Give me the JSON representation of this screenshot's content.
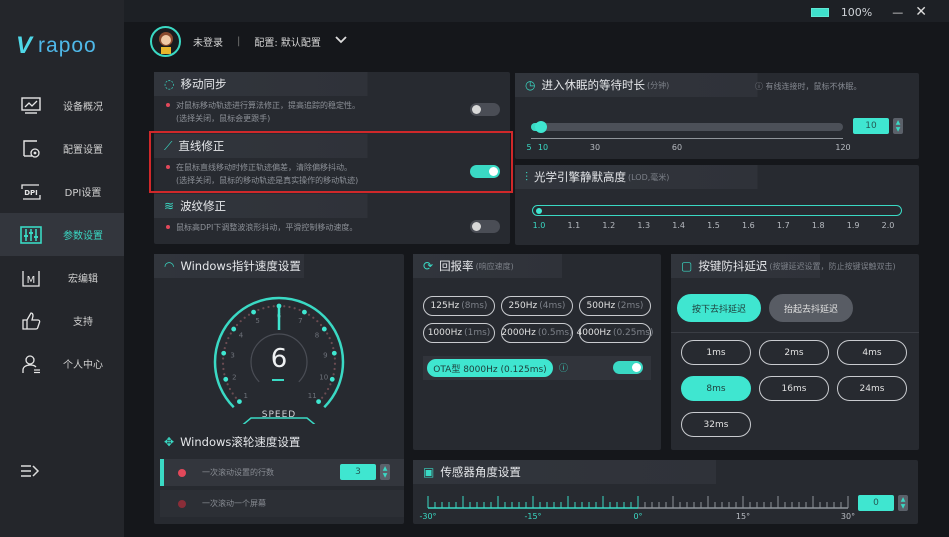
{
  "app": {
    "logo_mark": "V",
    "logo_text": "rapoo"
  },
  "window": {
    "battery": "100%",
    "minimize": "—",
    "close": "✕"
  },
  "sidebar": {
    "items": [
      {
        "label": "设备概况",
        "icon": "monitor-chart-icon"
      },
      {
        "label": "配置设置",
        "icon": "config-gear-icon"
      },
      {
        "label": "DPI设置",
        "icon": "dpi-icon"
      },
      {
        "label": "参数设置",
        "icon": "sliders-icon",
        "active": true
      },
      {
        "label": "宏编辑",
        "icon": "macro-m-icon"
      },
      {
        "label": "支持",
        "icon": "thumbs-up-icon"
      },
      {
        "label": "个人中心",
        "icon": "user-center-icon"
      }
    ],
    "collapse_icon": "menu-collapse-icon"
  },
  "header": {
    "user": "未登录",
    "separator": "|",
    "profile": "配置: 默认配置"
  },
  "motion_sync": {
    "title": "移动同步",
    "desc1": "对鼠标移动轨迹进行算法修正，提高追踪的稳定性。",
    "desc2": "(选择关闭，鼠标会更跟手)",
    "enabled": false
  },
  "angle_snap": {
    "title": "直线修正",
    "desc1": "在鼠标直线移动时修正轨迹偏差，清除偏移抖动。",
    "desc2": "(选择关闭，鼠标的移动轨迹是真实操作的移动轨迹)",
    "enabled": true
  },
  "ripple": {
    "title": "波纹修正",
    "desc1": "鼠标高DPI下调整波浪形抖动，平滑控制移动速度。",
    "enabled": false
  },
  "sleep": {
    "title": "进入休眠的等待时长",
    "unit": "(分钟)",
    "note": "有线连接时，鼠标不休眠。",
    "value": "10",
    "min": 5,
    "max": 120,
    "ticks": [
      "5",
      "10",
      "30",
      "60",
      "120"
    ]
  },
  "lod": {
    "title": "光学引擎静默高度",
    "unit": "(LOD,毫米)",
    "value": 1.0,
    "ticks": [
      "1.0",
      "1.1",
      "1.2",
      "1.3",
      "1.4",
      "1.5",
      "1.6",
      "1.7",
      "1.8",
      "1.9",
      "2.0"
    ]
  },
  "pointer": {
    "title": "Windows指针速度设置",
    "value": "6",
    "label": "SPEED",
    "scale": [
      "1",
      "2",
      "3",
      "4",
      "5",
      "6",
      "7",
      "8",
      "9",
      "10",
      "11"
    ]
  },
  "scroll": {
    "title": "Windows滚轮速度设置",
    "opt1": "一次滚动设置的行数",
    "opt1_value": "3",
    "opt2": "一次滚动一个屏幕"
  },
  "polling": {
    "title": "回报率",
    "unit": "(响应速度)",
    "rates": [
      {
        "hz": "125Hz",
        "ms": "(8ms)"
      },
      {
        "hz": "250Hz",
        "ms": "(4ms)"
      },
      {
        "hz": "500Hz",
        "ms": "(2ms)"
      },
      {
        "hz": "1000Hz",
        "ms": "(1ms)"
      },
      {
        "hz": "2000Hz",
        "ms": "(0.5ms)"
      },
      {
        "hz": "4000Hz",
        "ms": "(0.25ms)"
      }
    ],
    "ota": "OTA型 8000Hz (0.125ms)",
    "ota_enabled": true
  },
  "debounce": {
    "title": "按键防抖延迟",
    "unit": "(按键延迟设置，防止按键误触双击)",
    "tab_press": "按下去抖延迟",
    "tab_release": "抬起去抖延迟",
    "options": [
      "1ms",
      "2ms",
      "4ms",
      "8ms",
      "16ms",
      "24ms",
      "32ms"
    ],
    "selected": "8ms"
  },
  "sensor": {
    "title": "传感器角度设置",
    "value": "0",
    "ticks": [
      "-30°",
      "-15°",
      "0°",
      "15°",
      "30°"
    ]
  }
}
